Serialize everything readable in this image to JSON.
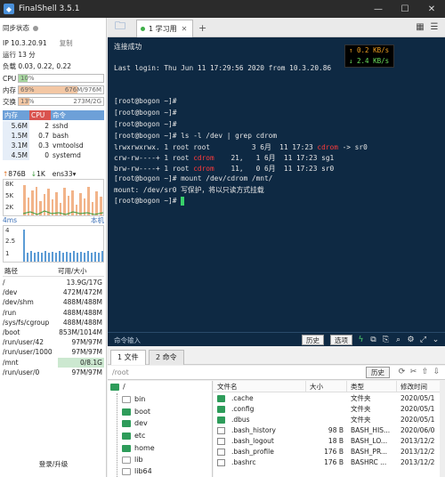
{
  "window": {
    "title": "FinalShell 3.5.1"
  },
  "sidebar": {
    "sync_status": "同步状态",
    "ip": "IP 10.3.20.91",
    "copy": "复制",
    "uptime": "运行 13 分",
    "load": "负载 0.03, 0.22, 0.22",
    "cpu": {
      "label": "CPU",
      "value": "10%",
      "percent": 10
    },
    "mem": {
      "label": "内存",
      "value": "69%",
      "detail": "676M/976M",
      "percent": 69
    },
    "swap": {
      "label": "交换",
      "value": "13%",
      "detail": "273M/2G",
      "percent": 13
    },
    "proc_headers": [
      "内存",
      "CPU",
      "命令"
    ],
    "processes": [
      {
        "mem": "5.6M",
        "cpu": "2",
        "cmd": "sshd"
      },
      {
        "mem": "1.5M",
        "cpu": "0.7",
        "cmd": "bash"
      },
      {
        "mem": "3.1M",
        "cpu": "0.3",
        "cmd": "vmtoolsd"
      },
      {
        "mem": "4.5M",
        "cpu": "0",
        "cmd": "systemd"
      }
    ],
    "net": {
      "up": "876B",
      "down": "1K",
      "iface": "ens33",
      "scale": [
        "8K",
        "5K",
        "2K"
      ]
    },
    "latency": {
      "label": "4ms",
      "host": "本机",
      "scale": [
        "4",
        "2.5",
        "1"
      ]
    },
    "disk_headers": [
      "路径",
      "可用/大小"
    ],
    "disks": [
      {
        "path": "/",
        "size": "13.9G/17G",
        "used": 0.18
      },
      {
        "path": "/dev",
        "size": "472M/472M",
        "used": 0
      },
      {
        "path": "/dev/shm",
        "size": "488M/488M",
        "used": 0
      },
      {
        "path": "/run",
        "size": "488M/488M",
        "used": 0
      },
      {
        "path": "/sys/fs/cgroup",
        "size": "488M/488M",
        "used": 0
      },
      {
        "path": "/boot",
        "size": "853M/1014M",
        "used": 0.16
      },
      {
        "path": "/run/user/42",
        "size": "97M/97M",
        "used": 0
      },
      {
        "path": "/run/user/1000",
        "size": "97M/97M",
        "used": 0
      },
      {
        "path": "/mnt",
        "size": "0/8.1G",
        "used": 1
      },
      {
        "path": "/run/user/0",
        "size": "97M/97M",
        "used": 0
      }
    ],
    "login": "登录/升级"
  },
  "tabs": {
    "active": "1 学习用"
  },
  "terminal": {
    "lines": [
      "连接成功",
      "",
      "Last login: Thu Jun 11 17:29:56 2020 from 10.3.20.86",
      "",
      "",
      "[root@bogon ~]#",
      "[root@bogon ~]#",
      "[root@bogon ~]#",
      "[root@bogon ~]# ls -l /dev | grep cdrom"
    ],
    "ls_rows": [
      {
        "pre": "lrwxrwxrwx. 1 root root          3 6月  11 17:23 ",
        "hl": "cdrom",
        "post": " -> sr0"
      },
      {
        "pre": "crw-rw----+ 1 root ",
        "hl": "cdrom",
        "post": "    21,   1 6月  11 17:23 sg1"
      },
      {
        "pre": "brw-rw----+ 1 root ",
        "hl": "cdrom",
        "post": "    11,   0 6月  11 17:23 sr0"
      }
    ],
    "tail": [
      "[root@bogon ~]# mount /dev/cdrom /mnt/",
      "mount: /dev/sr0 写保护，将以只读方式挂载",
      "[root@bogon ~]# "
    ],
    "net_up": "↑ 0.2 KB/s",
    "net_down": "↓ 2.4 KB/s"
  },
  "cmdbar": {
    "placeholder": "命令输入",
    "history": "历史",
    "options": "选项"
  },
  "filepanel": {
    "tab_files": "1 文件",
    "tab_cmd": "2 命令",
    "path": "/root",
    "history": "历史",
    "tree_root": "/",
    "tree": [
      "bin",
      "boot",
      "dev",
      "etc",
      "home",
      "lib",
      "lib64"
    ],
    "columns": [
      "文件名",
      "大小",
      "类型",
      "修改时间"
    ],
    "files": [
      {
        "name": ".cache",
        "size": "",
        "type": "文件夹",
        "time": "2020/05/1",
        "dir": true
      },
      {
        "name": ".config",
        "size": "",
        "type": "文件夹",
        "time": "2020/05/1",
        "dir": true
      },
      {
        "name": ".dbus",
        "size": "",
        "type": "文件夹",
        "time": "2020/05/1",
        "dir": true
      },
      {
        "name": ".bash_history",
        "size": "98 B",
        "type": "BASH_HIS...",
        "time": "2020/06/0",
        "dir": false
      },
      {
        "name": ".bash_logout",
        "size": "18 B",
        "type": "BASH_LO...",
        "time": "2013/12/2",
        "dir": false
      },
      {
        "name": ".bash_profile",
        "size": "176 B",
        "type": "BASH_PR...",
        "time": "2013/12/2",
        "dir": false
      },
      {
        "name": ".bashrc",
        "size": "176 B",
        "type": "BASHRC ...",
        "time": "2013/12/2",
        "dir": false
      }
    ]
  },
  "colors": {
    "terminal_bg": "#0e2943",
    "highlight": "#ff3b3b",
    "accent": "#6da0d8"
  }
}
